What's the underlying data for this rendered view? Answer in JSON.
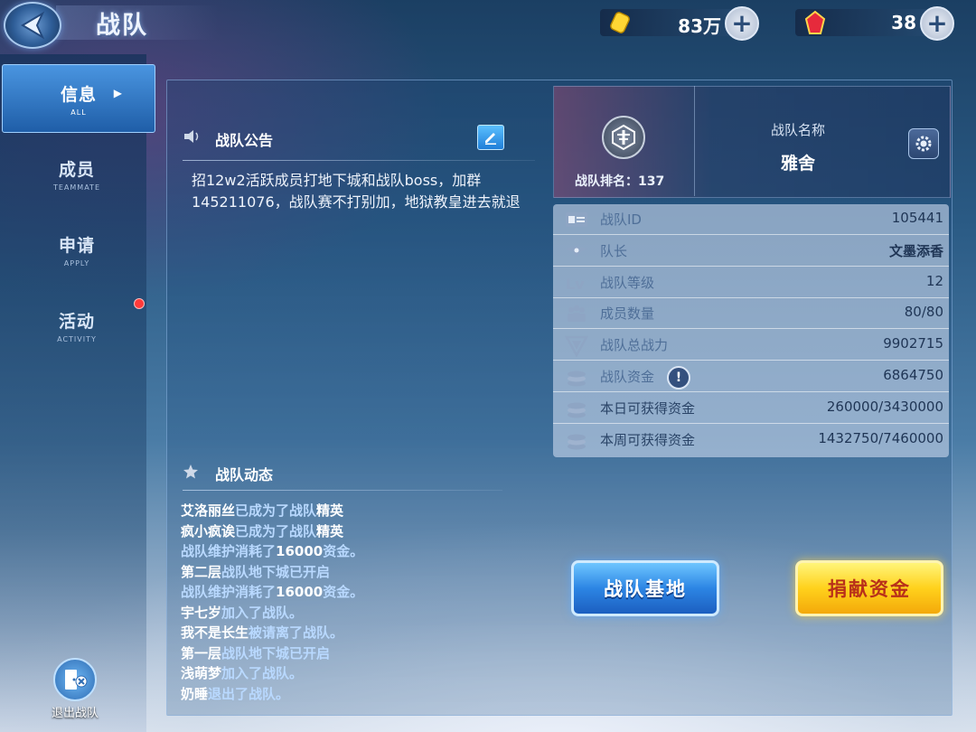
{
  "header": {
    "title": "战队",
    "gold": "83万",
    "gems": "38"
  },
  "sidebar": {
    "items": [
      {
        "label": "信息",
        "sub": "ALL"
      },
      {
        "label": "成员",
        "sub": "TEAMMATE"
      },
      {
        "label": "申请",
        "sub": "APPLY"
      },
      {
        "label": "活动",
        "sub": "ACTIVITY"
      }
    ],
    "exit_label": "退出战队"
  },
  "notice": {
    "heading": "战队公告",
    "text": "招12w2活跃成员打地下城和战队boss，加群145211076，战队赛不打别加，地狱教皇进去就退"
  },
  "activity": {
    "heading": "战队动态",
    "entries": [
      {
        "name": "艾洛丽丝",
        "text": "已成为了战队",
        "tail": "精英"
      },
      {
        "name": "疯小疯诶",
        "text": "已成为了战队",
        "tail": "精英"
      },
      {
        "name": "",
        "text": "战队维护消耗了",
        "tail": "16000",
        "end": "资金。"
      },
      {
        "name": "第二层",
        "text": "战队地下城已开启",
        "tail": ""
      },
      {
        "name": "",
        "text": "战队维护消耗了",
        "tail": "16000",
        "end": "资金。"
      },
      {
        "name": "宇七岁",
        "text": "加入了战队。",
        "tail": ""
      },
      {
        "name": "我不是长生",
        "text": "被请离了战队。",
        "tail": ""
      },
      {
        "name": "第一层",
        "text": "战队地下城已开启",
        "tail": ""
      },
      {
        "name": "浅萌梦",
        "text": "加入了战队。",
        "tail": ""
      },
      {
        "name": "奶睡",
        "text": "退出了战队。",
        "tail": ""
      }
    ]
  },
  "team": {
    "rank_label": "战队排名：",
    "rank_value": "137",
    "name_label": "战队名称",
    "name_value": "雅舍",
    "stats": [
      {
        "label": "战队ID",
        "value": "105441",
        "icon": "id-card-icon",
        "dim": true
      },
      {
        "label": "队长",
        "value": "文墨添香",
        "icon": "captain-wings-icon",
        "bold": true,
        "dim": true
      },
      {
        "label": "战队等级",
        "value": "12",
        "icon": "level-icon",
        "dim": true
      },
      {
        "label": "成员数量",
        "value": "80/80",
        "icon": "members-icon",
        "dim": true
      },
      {
        "label": "战队总战力",
        "value": "9902715",
        "icon": "power-icon",
        "dim": true
      },
      {
        "label": "战队资金",
        "value": "6864750",
        "icon": "coins-icon",
        "dim": true,
        "warn": "!"
      },
      {
        "label": "本日可获得资金",
        "value": "260000/3430000",
        "icon": "coins-icon",
        "dim": false
      },
      {
        "label": "本周可获得资金",
        "value": "1432750/7460000",
        "icon": "coins-icon",
        "dim": false
      }
    ]
  },
  "buttons": {
    "base": "战队基地",
    "donate": "捐献资金"
  }
}
